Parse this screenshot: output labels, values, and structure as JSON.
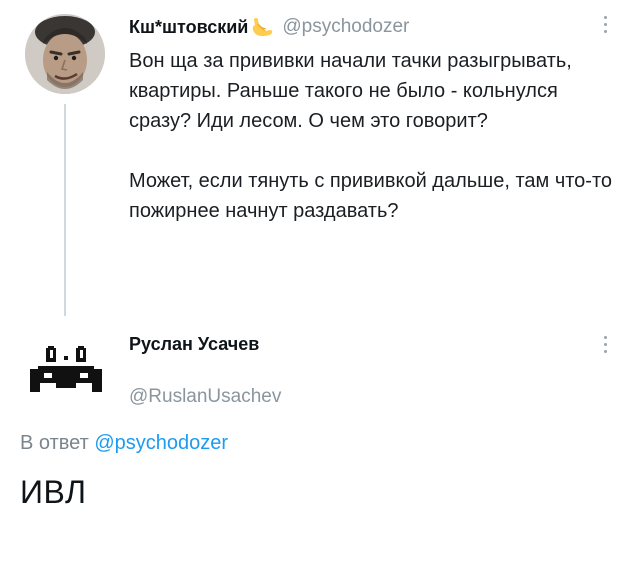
{
  "tweet1": {
    "display_name": "Кш*штовский",
    "name_emoji": "call-me-hand-emoji",
    "handle": "@psychodozer",
    "paragraphs": [
      "Вон ща за прививки начали тачки разыгрывать, квартиры. Раньше такого не было - кольнулся сразу? Иди лесом. О чем это говорит?",
      "Может, если тянуть с прививкой дальше, там что-то пожирнее начнут раздавать?"
    ]
  },
  "tweet2": {
    "display_name": "Руслан Усачев",
    "handle": "@RuslanUsachev",
    "reply_prefix": "В ответ",
    "reply_to": "@psychodozer",
    "text": "ИВЛ"
  },
  "colors": {
    "link": "#1d9bf0",
    "secondary_text": "#8a959e",
    "thread_line": "#cfd9de"
  }
}
